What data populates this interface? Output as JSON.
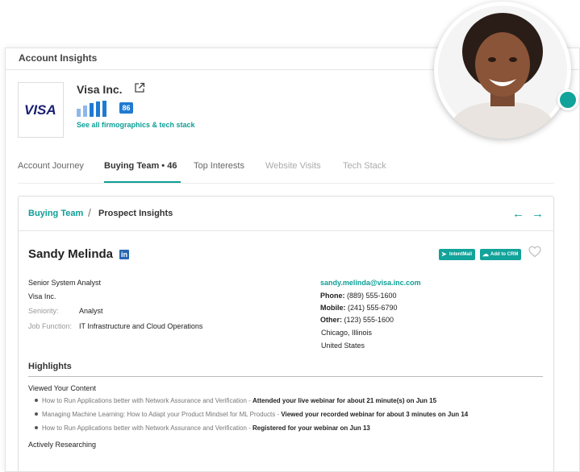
{
  "card": {
    "title": "Account Insights"
  },
  "company": {
    "name": "Visa Inc.",
    "logo_text": "VISA",
    "score": "86",
    "firmographics_link": "See all firmographics & tech stack"
  },
  "tabs": [
    {
      "label": "Account Journey"
    },
    {
      "label": "Buying Team • 46"
    },
    {
      "label": "Top Interests"
    },
    {
      "label": "Website Visits"
    },
    {
      "label": "Tech Stack"
    }
  ],
  "breadcrumb": {
    "parent": "Buying Team",
    "separator": "/",
    "current": "Prospect Insights"
  },
  "nav": {
    "prev": "←",
    "next": "→"
  },
  "prospect": {
    "name": "Sandy Melinda",
    "linkedin_label": "in",
    "intentmail_label": "IntentMail",
    "crm_label": "Add to CRM",
    "title": "Senior System Analyst",
    "company": "Visa Inc.",
    "seniority_label": "Seniority:",
    "seniority": "Analyst",
    "job_function_label": "Job Function:",
    "job_function": "IT Infrastructure and Cloud Operations",
    "email": "sandy.melinda@visa.inc.com",
    "phone_label": "Phone:",
    "phone": "(889) 555-1600",
    "mobile_label": "Mobile:",
    "mobile": "(241) 555-6790",
    "other_label": "Other:",
    "other": "(123) 555-1600",
    "city": "Chicago, Illinois",
    "country": "United States"
  },
  "highlights": {
    "title": "Highlights",
    "viewed_heading": "Viewed Your Content",
    "items": [
      {
        "content": "How to Run Applications better with Network Assurance and Verification - ",
        "action": "Attended your live webinar for about 21 minute(s) on Jun 15"
      },
      {
        "content": "Managing Machine Learning: How to Adapt your Product Mindset for ML Products - ",
        "action": "Viewed your recorded webinar for about 3 minutes on Jun 14"
      },
      {
        "content": "How to Run Applications better with Network Assurance and Verification - ",
        "action": "Registered for your webinar on Jun 13"
      }
    ],
    "researching_heading": "Actively Researching"
  },
  "colors": {
    "accent": "#0d9e96",
    "score_badge": "#1e7ad2",
    "linkedin": "#2867b2",
    "visa_blue": "#1a1f71"
  },
  "icons": [
    "external-link-icon",
    "signal-bars-icon",
    "linkedin-icon",
    "heart-icon",
    "send-icon",
    "cloud-upload-icon",
    "arrow-left-icon",
    "arrow-right-icon"
  ]
}
